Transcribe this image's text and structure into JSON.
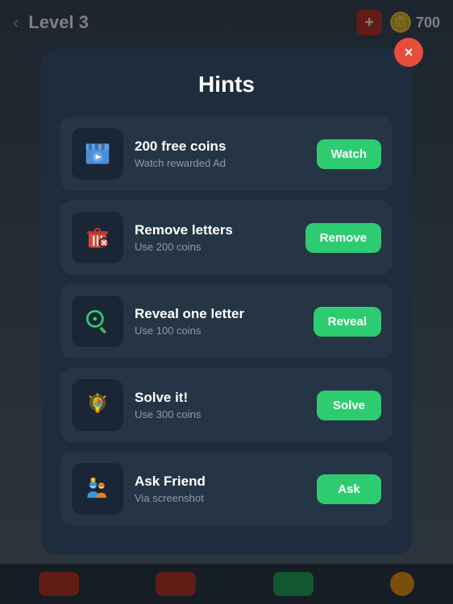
{
  "topBar": {
    "back": "‹",
    "levelLabel": "Level 3",
    "addCoin": "+",
    "coinCount": "700"
  },
  "modal": {
    "title": "Hints",
    "closeLabel": "×",
    "hints": [
      {
        "id": "free-coins",
        "name": "200 free coins",
        "desc": "Watch rewarded Ad",
        "btnLabel": "Watch",
        "iconType": "clapboard"
      },
      {
        "id": "remove-letters",
        "name": "Remove letters",
        "desc": "Use 200 coins",
        "btnLabel": "Remove",
        "iconType": "remove"
      },
      {
        "id": "reveal-letter",
        "name": "Reveal one letter",
        "desc": "Use 100 coins",
        "btnLabel": "Reveal",
        "iconType": "magnify"
      },
      {
        "id": "solve-it",
        "name": "Solve it!",
        "desc": "Use 300 coins",
        "btnLabel": "Solve",
        "iconType": "bulb"
      },
      {
        "id": "ask-friend",
        "name": "Ask Friend",
        "desc": "Via screenshot",
        "btnLabel": "Ask",
        "iconType": "friend"
      }
    ]
  }
}
